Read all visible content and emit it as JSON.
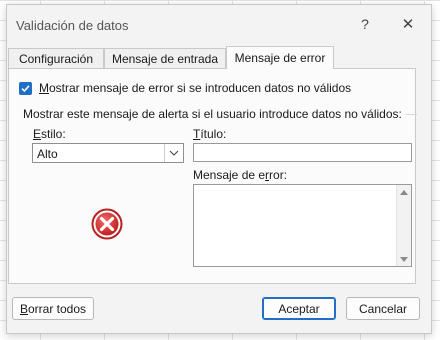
{
  "window": {
    "title": "Validación de datos",
    "help_glyph": "?",
    "close_glyph": "✕"
  },
  "tabs": [
    {
      "label": "Configuración",
      "active": false
    },
    {
      "label": "Mensaje de entrada",
      "active": false
    },
    {
      "label": "Mensaje de error",
      "active": true
    }
  ],
  "show_error": {
    "checked": true,
    "label_first": "M",
    "label_rest": "ostrar mensaje de error si se introducen datos no válidos"
  },
  "group_label": "Mostrar este mensaje de alerta si el usuario introduce datos no válidos:",
  "style_field": {
    "label_first": "E",
    "label_rest": "stilo:",
    "selected": "Alto"
  },
  "title_field": {
    "label_first": "T",
    "label_rest": "ítulo:",
    "value": ""
  },
  "message_field": {
    "label_start": "Mensaje de e",
    "label_u": "r",
    "label_end": "ror:",
    "value": ""
  },
  "buttons": {
    "clear_first": "B",
    "clear_rest": "orrar todos",
    "ok": "Aceptar",
    "cancel": "Cancelar"
  },
  "icons": {
    "style_icon": "error-stop-icon"
  },
  "colors": {
    "accent": "#1f6fc7",
    "error_red": "#d12f2f"
  }
}
